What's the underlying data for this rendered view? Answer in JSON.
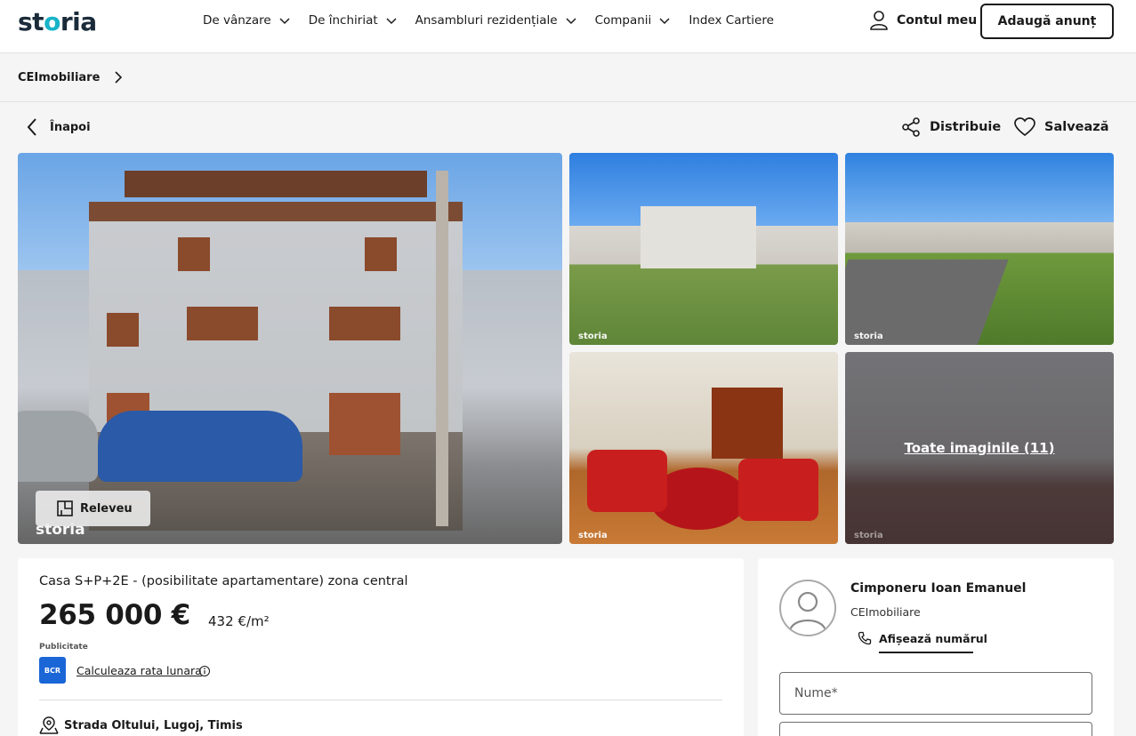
{
  "header": {
    "logo": {
      "prefix": "st",
      "o": "o",
      "suffix": "ria"
    },
    "nav": [
      {
        "label": "De vânzare",
        "has_dropdown": true
      },
      {
        "label": "De închiriat",
        "has_dropdown": true
      },
      {
        "label": "Ansambluri rezidențiale",
        "has_dropdown": true
      },
      {
        "label": "Companii",
        "has_dropdown": true
      },
      {
        "label": "Index Cartiere",
        "has_dropdown": false
      }
    ],
    "account_label": "Contul meu",
    "add_button": "Adaugă anunț"
  },
  "breadcrumb": {
    "label": "CEImobiliare"
  },
  "actions": {
    "back": "Înapoi",
    "share": "Distribuie",
    "save": "Salvează"
  },
  "gallery": {
    "watermark": "storia",
    "releveu_label": "Releveu",
    "all_images_label": "Toate imaginile (11)"
  },
  "listing": {
    "title": "Casa S+P+2E - (posibilitate apartamentare) zona central",
    "price": "265 000 €",
    "price_per_m2": "432 €/m²",
    "ad_label": "Publicitate",
    "bank_logo": "BCR",
    "calc_link": "Calculeaza rata lunara",
    "address": "Strada Oltului, Lugoj, Timis"
  },
  "agent": {
    "name": "Cimponeru Ioan Emanuel",
    "agency": "CEImobiliare",
    "show_phone": "Afișează numărul"
  },
  "form": {
    "name_placeholder": "Nume*",
    "second_placeholder": ""
  },
  "colors": {
    "brand_teal": "#17b3c9",
    "bcr_blue": "#1a66d6",
    "text": "#1a1a1a"
  }
}
